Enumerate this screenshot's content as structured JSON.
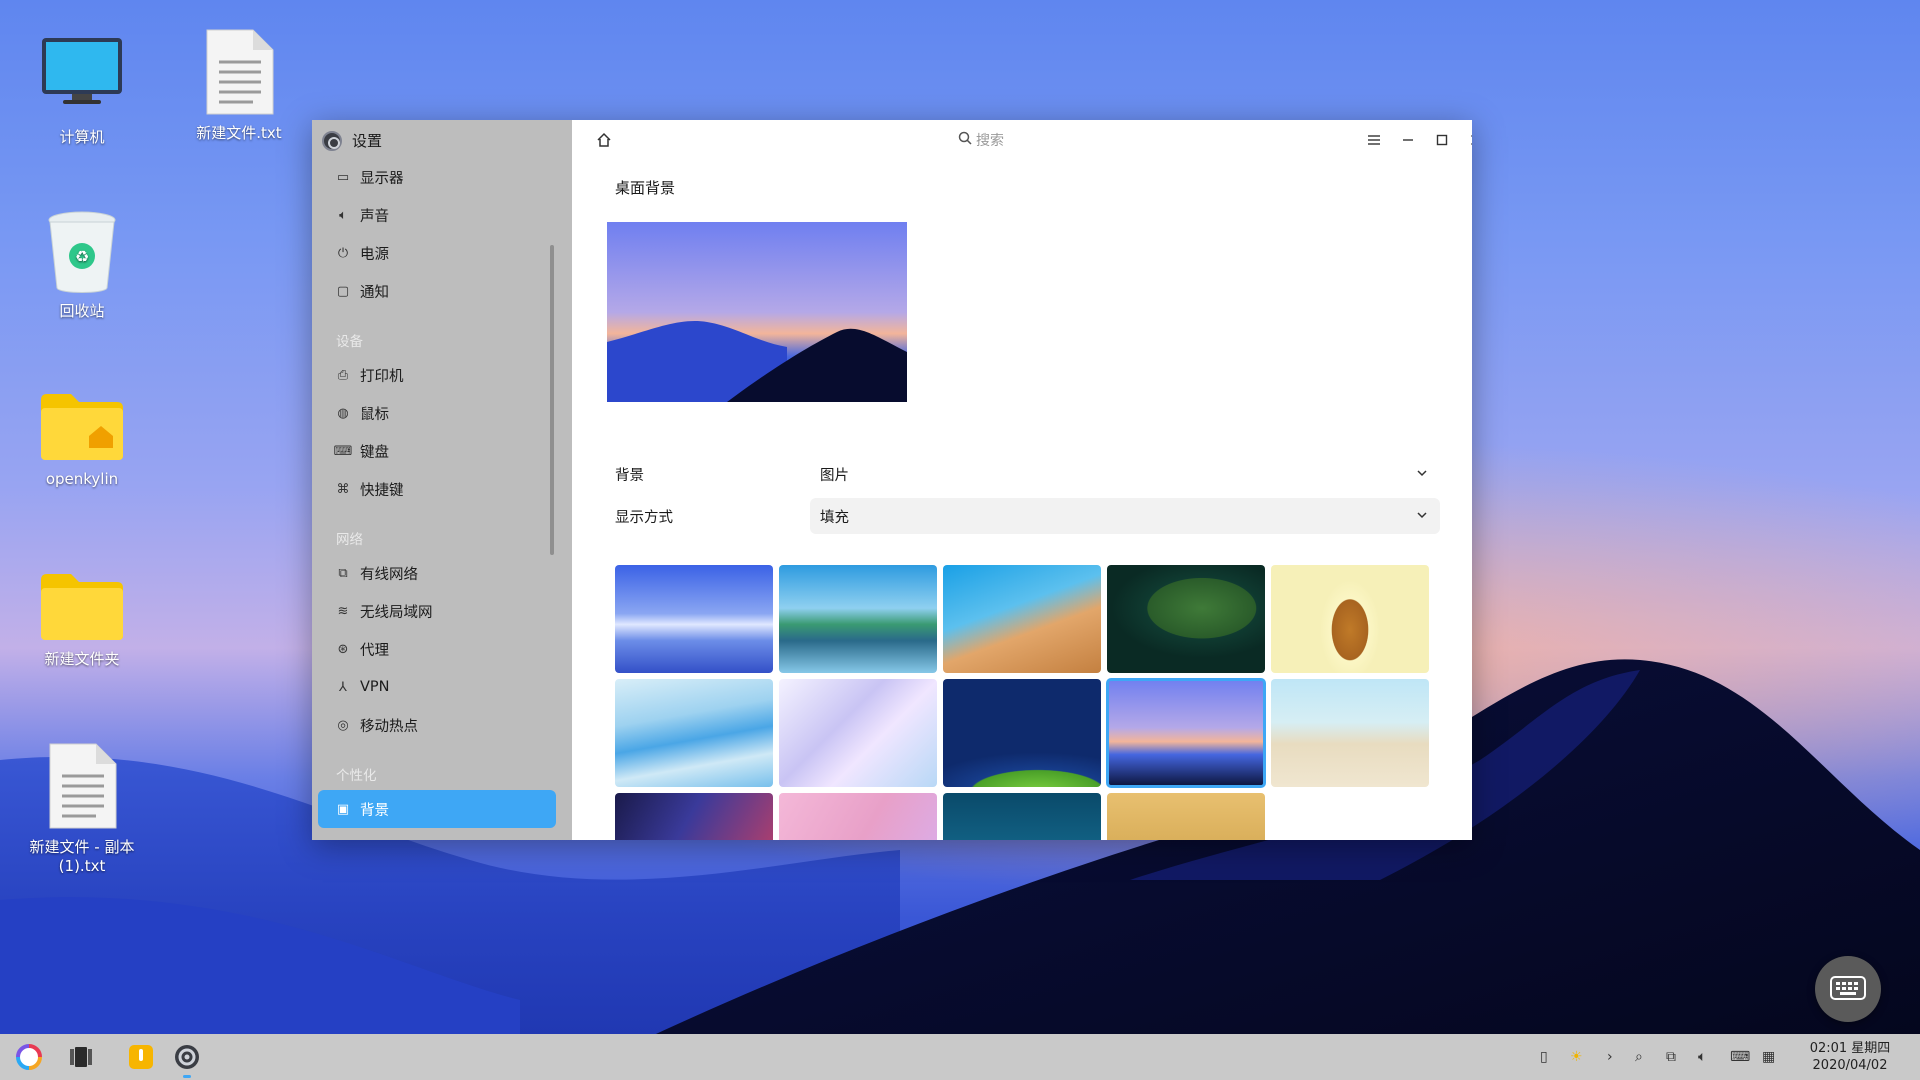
{
  "desktop": {
    "icons": [
      {
        "label": "计算机",
        "icon": "computer-icon"
      },
      {
        "label": "新建文件.txt",
        "icon": "text-file-icon"
      },
      {
        "label": "回收站",
        "icon": "recycle-bin-icon"
      },
      {
        "label": "openkylin",
        "icon": "home-folder-icon"
      },
      {
        "label": "新建文件夹",
        "icon": "folder-icon"
      },
      {
        "label": "新建文件 - 副本\n(1).txt",
        "icon": "text-file-icon"
      }
    ]
  },
  "settings": {
    "app_title": "设置",
    "search_placeholder": "搜索",
    "nav": {
      "system": [
        "显示器",
        "声音",
        "电源",
        "通知"
      ],
      "group_devices": "设备",
      "devices": [
        "打印机",
        "鼠标",
        "键盘",
        "快捷键"
      ],
      "group_network": "网络",
      "network": [
        "有线网络",
        "无线局域网",
        "代理",
        "VPN",
        "移动热点"
      ],
      "group_personalize": "个性化",
      "personalize": [
        "背景"
      ],
      "active": "背景"
    },
    "main": {
      "section_title": "桌面背景",
      "background_label": "背景",
      "background_value": "图片",
      "display_mode_label": "显示方式",
      "display_mode_value": "填充",
      "selected_wallpaper_index": 8,
      "wallpaper_count": 14
    }
  },
  "taskbar": {
    "time": "02:01 星期四",
    "date": "2020/04/02",
    "tray_icons": [
      "clipboard-icon",
      "brightness-icon",
      "expand-arrow-icon",
      "search-icon",
      "network-icon",
      "volume-icon",
      "keyboard-layout-icon",
      "input-method-icon"
    ]
  },
  "colors": {
    "accent": "#3ea7f5",
    "sidebar_bg": "#bdbdbd",
    "taskbar_bg": "#c9c9c9"
  }
}
